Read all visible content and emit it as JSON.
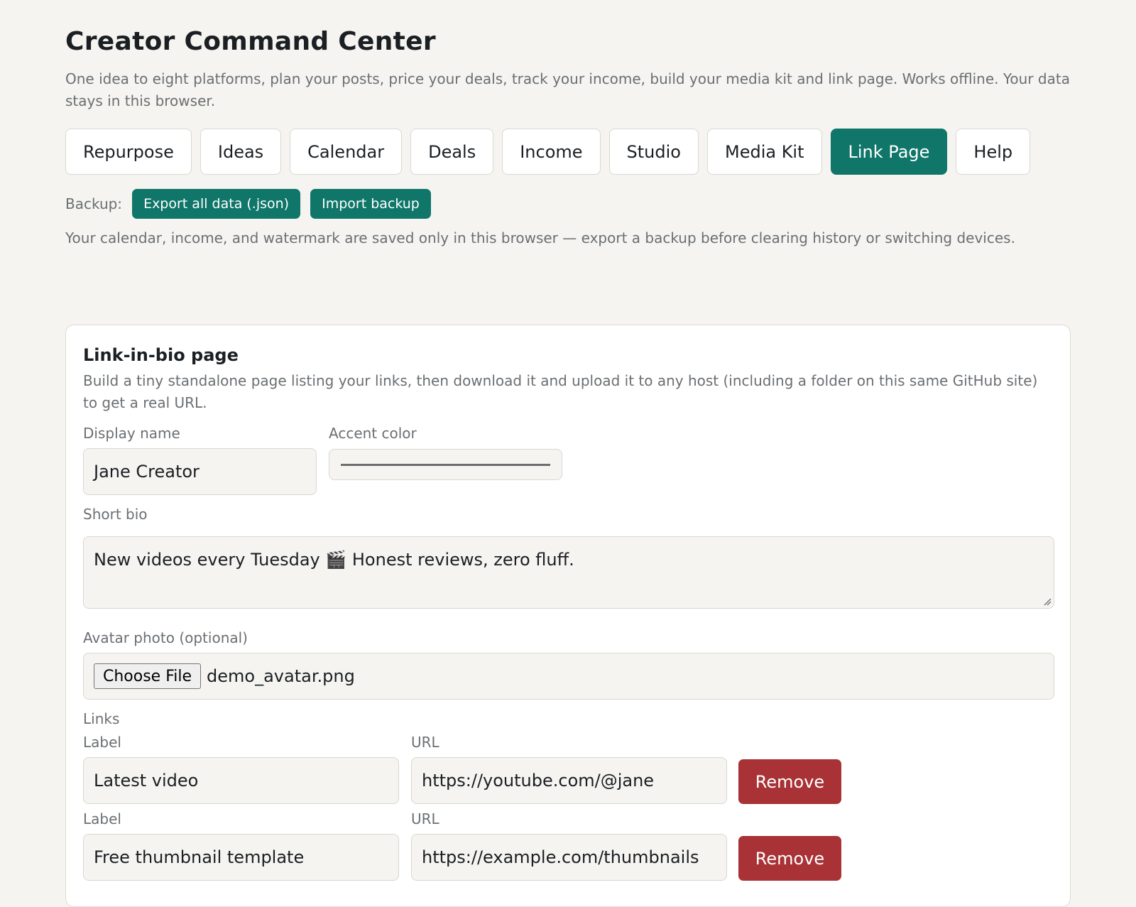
{
  "app": {
    "title": "Creator Command Center",
    "subtitle": "One idea to eight platforms, plan your posts, price your deals, track your income, build your media kit and link page. Works offline. Your data stays in this browser."
  },
  "tabs": [
    {
      "label": "Repurpose",
      "active": false
    },
    {
      "label": "Ideas",
      "active": false
    },
    {
      "label": "Calendar",
      "active": false
    },
    {
      "label": "Deals",
      "active": false
    },
    {
      "label": "Income",
      "active": false
    },
    {
      "label": "Studio",
      "active": false
    },
    {
      "label": "Media Kit",
      "active": false
    },
    {
      "label": "Link Page",
      "active": true
    },
    {
      "label": "Help",
      "active": false
    }
  ],
  "backup": {
    "label": "Backup:",
    "export_label": "Export all data (.json)",
    "import_label": "Import backup",
    "note": "Your calendar, income, and watermark are saved only in this browser — export a backup before clearing history or switching devices."
  },
  "link_page": {
    "title": "Link-in-bio page",
    "description": "Build a tiny standalone page listing your links, then download it and upload it to any host (including a folder on this same GitHub site) to get a real URL.",
    "display_name_label": "Display name",
    "display_name_value": "Jane Creator",
    "accent_color_label": "Accent color",
    "short_bio_label": "Short bio",
    "short_bio_value": "New videos every Tuesday 🎬 Honest reviews, zero fluff.",
    "avatar_label": "Avatar photo (optional)",
    "choose_file_label": "Choose File",
    "avatar_file_name": "demo_avatar.png",
    "links_label": "Links",
    "links": [
      {
        "label_caption": "Label",
        "label_value": "Latest video",
        "url_caption": "URL",
        "url_value": "https://youtube.com/@jane",
        "remove_label": "Remove"
      },
      {
        "label_caption": "Label",
        "label_value": "Free thumbnail template",
        "url_caption": "URL",
        "url_value": "https://example.com/thumbnails",
        "remove_label": "Remove"
      }
    ]
  },
  "colors": {
    "accent": "#0f7669",
    "danger": "#a83236",
    "background": "#f5f4f0"
  }
}
